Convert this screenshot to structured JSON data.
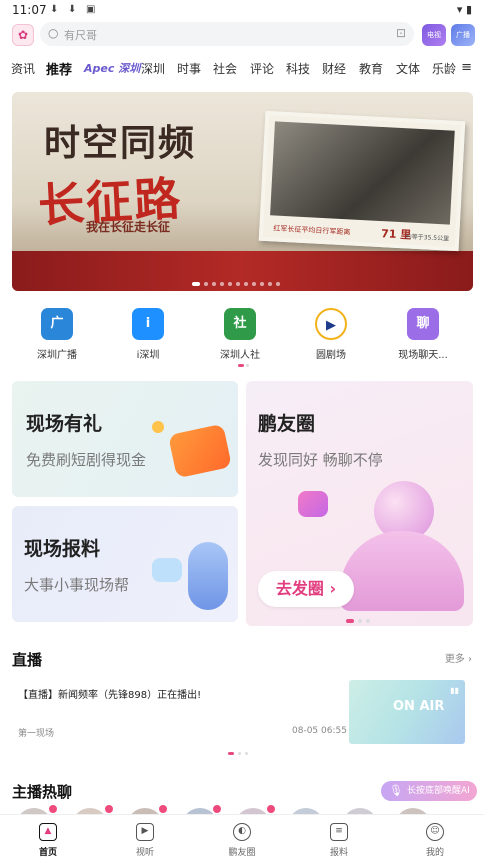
{
  "status_bar": {
    "time": "11:07",
    "icons": [
      "download-icon",
      "download-icon",
      "app-notification-icon"
    ],
    "right_icons": [
      "wifi-icon",
      "battery-icon"
    ]
  },
  "header": {
    "search_placeholder": "有尺哥",
    "right_buttons": [
      {
        "label": "电视",
        "color": "#8a63d9",
        "icon": "tv-icon"
      },
      {
        "label": "广播",
        "color": "#6b7fe0",
        "icon": "radio-icon"
      }
    ]
  },
  "tabs": [
    {
      "label": "资讯",
      "active": false
    },
    {
      "label": "推荐",
      "active": true
    },
    {
      "label": "Apec 深圳",
      "active": false,
      "special": true
    },
    {
      "label": "深圳",
      "active": false
    },
    {
      "label": "时事",
      "active": false
    },
    {
      "label": "社会",
      "active": false
    },
    {
      "label": "评论",
      "active": false
    },
    {
      "label": "科技",
      "active": false
    },
    {
      "label": "财经",
      "active": false
    },
    {
      "label": "教育",
      "active": false
    },
    {
      "label": "文体",
      "active": false
    },
    {
      "label": "乐龄",
      "active": false
    }
  ],
  "banner": {
    "title_line1": "时空同频",
    "title_line2": "长征路",
    "subtitle": "我在长征走长征",
    "photo_caption": "红军长征平均日行军距离",
    "photo_value": "71 里",
    "photo_note": "约等于35.5公里",
    "slide_count": 11,
    "active_slide": 0
  },
  "quick_icons": [
    {
      "label": "深圳广播",
      "icon": "shenzhen-radio-icon",
      "color": "#2a86d9",
      "glyph": "广"
    },
    {
      "label": "i深圳",
      "icon": "i-shenzhen-icon",
      "color": "#1e90ff",
      "glyph": "i"
    },
    {
      "label": "深圳人社",
      "icon": "shenzhen-hr-icon",
      "color": "#2f9b48",
      "glyph": "社"
    },
    {
      "label": "圆剧场",
      "icon": "theater-icon",
      "color": "#f5f5f5",
      "glyph": "▶"
    },
    {
      "label": "现场聊天...",
      "icon": "chat-icon",
      "color": "#9b6ee8",
      "glyph": "聊"
    }
  ],
  "cards": {
    "card1": {
      "title": "现场有礼",
      "subtitle": "免费刷短剧得现金"
    },
    "card2": {
      "title": "现场报料",
      "subtitle": "大事小事现场帮"
    },
    "card3": {
      "title": "鹏友圈",
      "subtitle": "发现同好 畅聊不停",
      "button": "去发圈 ›"
    }
  },
  "live": {
    "title": "直播",
    "more": "更多 ›",
    "item_title": "【直播】新闻频率（先锋898）正在播出!",
    "source": "第一现场",
    "time": "08-05 06:55",
    "thumb_text": "ON AIR"
  },
  "anchor": {
    "title": "主播热聊",
    "hint": "长按底部唤醒AI"
  },
  "bottom_nav": [
    {
      "label": "首页",
      "icon": "home-icon",
      "active": true
    },
    {
      "label": "视听",
      "icon": "video-icon",
      "active": false
    },
    {
      "label": "鹏友圈",
      "icon": "planet-icon",
      "active": false
    },
    {
      "label": "报料",
      "icon": "report-icon",
      "active": false
    },
    {
      "label": "我的",
      "icon": "profile-icon",
      "active": false
    }
  ]
}
